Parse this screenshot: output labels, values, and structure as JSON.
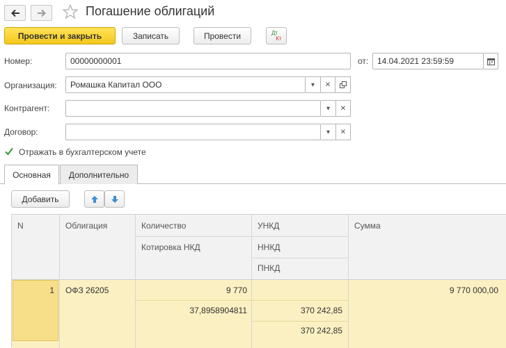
{
  "window": {
    "title": "Погашение облигаций"
  },
  "toolbar": {
    "post_close": "Провести и закрыть",
    "save": "Записать",
    "post": "Провести",
    "dt_icon_top": "Дт",
    "dt_icon_bottom": "Кт"
  },
  "form": {
    "number_label": "Номер:",
    "number_value": "00000000001",
    "date_label": "от:",
    "date_value": "14.04.2021 23:59:59",
    "org_label": "Организация:",
    "org_value": "Ромашка Капитал ООО",
    "contr_label": "Контрагент:",
    "contr_value": "",
    "contract_label": "Договор:",
    "contract_value": "",
    "checkbox_label": "Отражать в бухгалтерском учете",
    "checkbox_checked": true
  },
  "tabs": [
    {
      "label": "Основная",
      "active": true
    },
    {
      "label": "Дополнительно",
      "active": false
    }
  ],
  "table_toolbar": {
    "add": "Добавить"
  },
  "table": {
    "headers": {
      "n": "N",
      "bond": "Облигация",
      "qty": "Количество",
      "quote": "Котировка НКД",
      "unkd": "УНКД",
      "nnkd": "ННКД",
      "pnkd": "ПНКД",
      "sum": "Сумма"
    },
    "rows": [
      {
        "n": "1",
        "bond": "ОФЗ 26205",
        "qty": "9 770",
        "quote": "37,8958904811",
        "unkd": "",
        "nnkd": "370 242,85",
        "pnkd": "370 242,85",
        "sum": "9 770 000,00"
      }
    ]
  },
  "colors": {
    "primary": "#f3c81c",
    "row_highlight": "#fbf0c2",
    "cell_focus": "#f7df8a",
    "header_bg": "#f2f2f2",
    "arrow_blue": "#3d8fd6"
  }
}
